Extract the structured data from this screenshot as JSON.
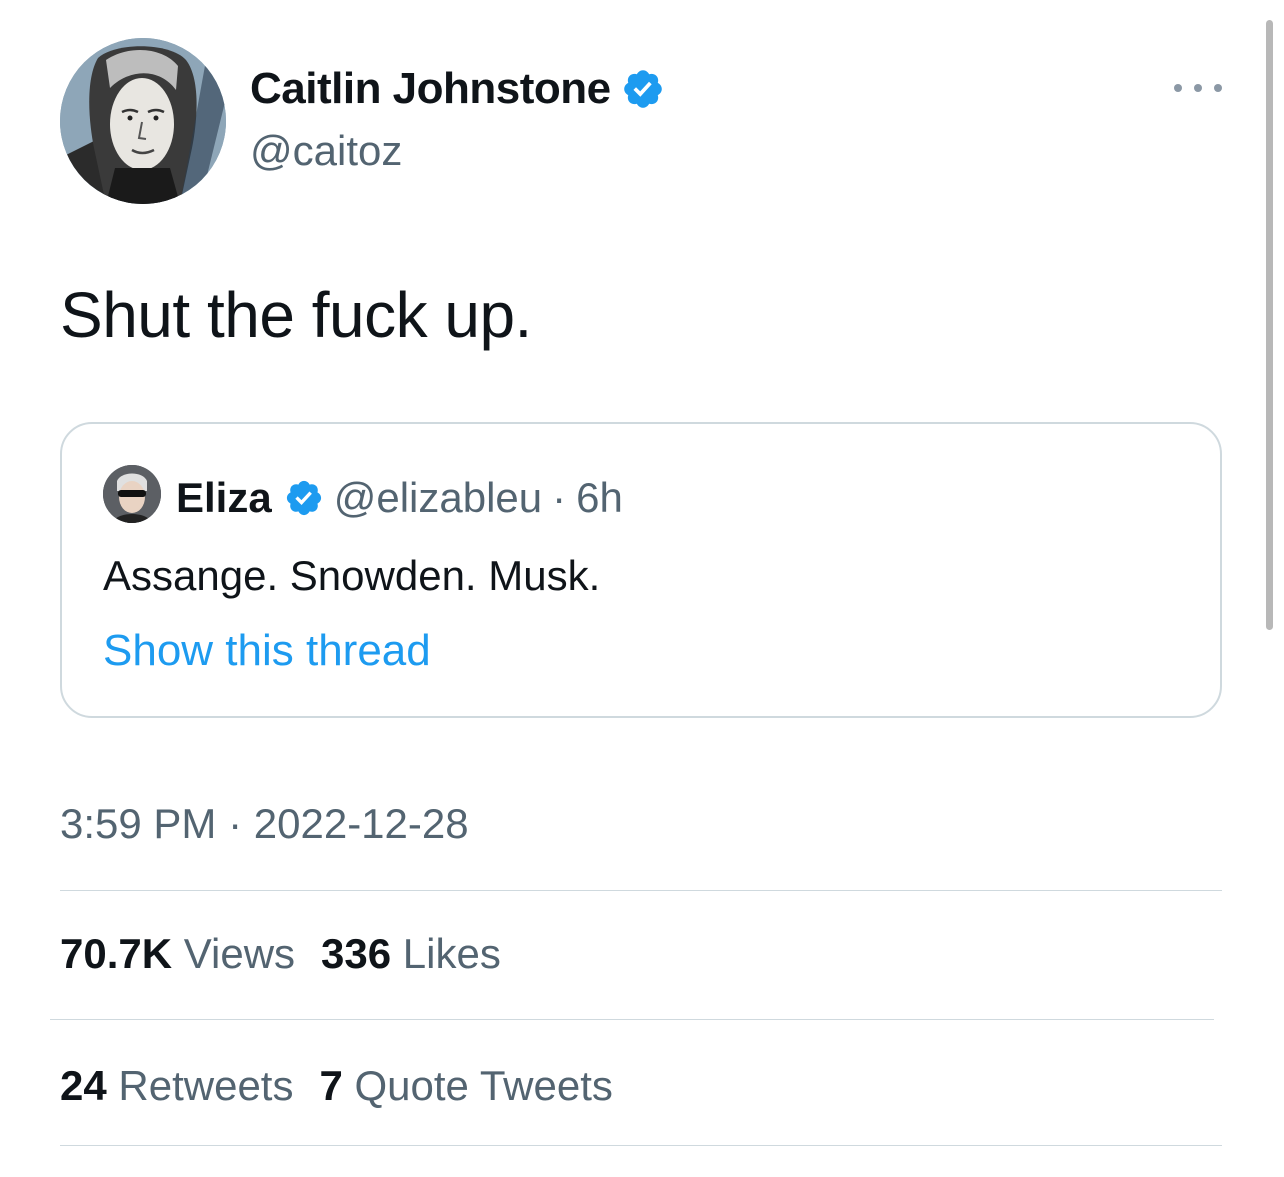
{
  "author": {
    "display_name": "Caitlin Johnstone",
    "handle": "@caitoz",
    "verified_icon": "verified-badge-icon"
  },
  "tweet": {
    "text": "Shut the fuck up."
  },
  "quoted": {
    "display_name": "Eliza",
    "handle": "@elizableu",
    "separator": "·",
    "time": "6h",
    "text": "Assange. Snowden. Musk.",
    "show_thread_label": "Show this thread"
  },
  "meta": {
    "time": "3:59 PM",
    "separator": "·",
    "date": "2022-12-28"
  },
  "stats": {
    "views_count": "70.7K",
    "views_label": "Views",
    "likes_count": "336",
    "likes_label": "Likes",
    "retweets_count": "24",
    "retweets_label": "Retweets",
    "quotes_count": "7",
    "quotes_label": "Quote Tweets"
  },
  "colors": {
    "accent": "#1d9bf0",
    "secondary_text": "#536471",
    "primary_text": "#0f1419",
    "border": "#cfd9de"
  }
}
